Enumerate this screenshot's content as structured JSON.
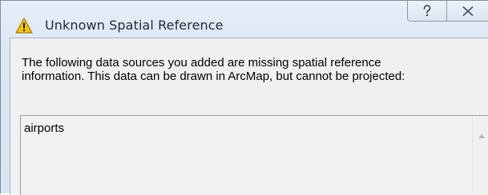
{
  "dialog": {
    "title": "Unknown Spatial Reference",
    "title_icon": "warning-icon",
    "help_icon": "question-mark-icon",
    "close_icon": "close-x-icon",
    "message_line1": "The following data sources you added are missing spatial reference",
    "message_line2": "information. This data can be drawn in ArcMap, but cannot be projected:",
    "list": {
      "items": [
        "airports"
      ],
      "scroll_up_icon": "scroll-up-arrow-icon"
    }
  },
  "colors": {
    "warning_fill": "#f5c400",
    "warning_stroke": "#a27a00",
    "title_text": "#1e2a38",
    "frame": "#d9e5f2"
  }
}
